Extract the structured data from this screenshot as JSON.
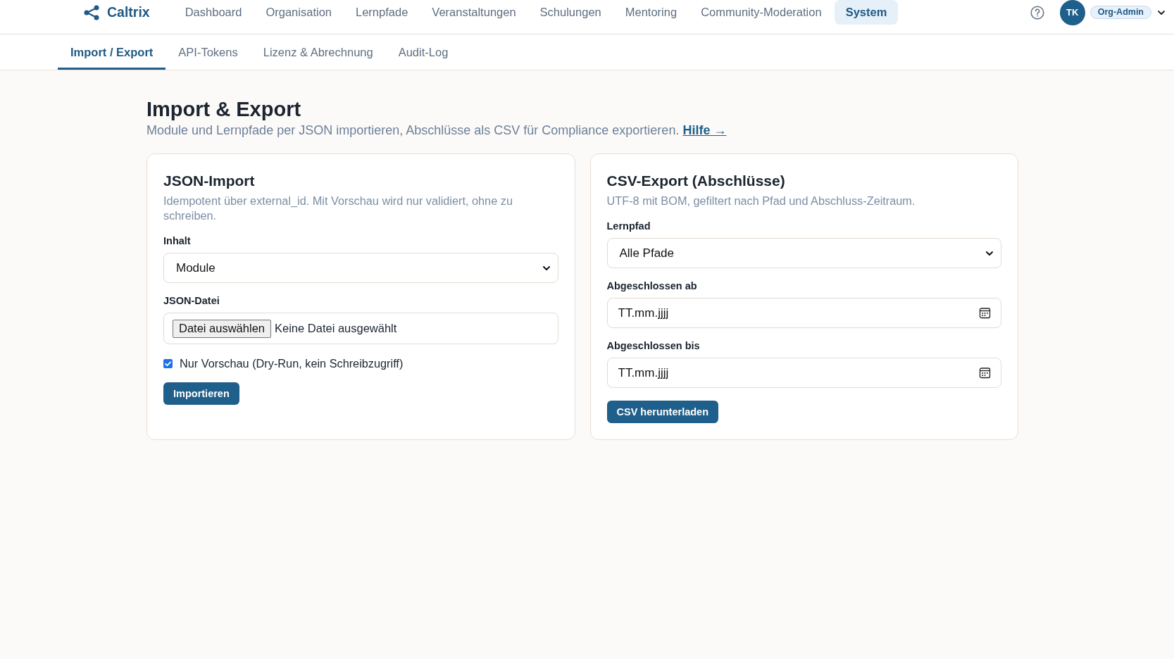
{
  "header": {
    "brand": "Caltrix",
    "nav": [
      {
        "label": "Dashboard",
        "selected": false
      },
      {
        "label": "Organisation",
        "selected": false
      },
      {
        "label": "Lernpfade",
        "selected": false
      },
      {
        "label": "Veranstaltungen",
        "selected": false
      },
      {
        "label": "Schulungen",
        "selected": false
      },
      {
        "label": "Mentoring",
        "selected": false
      },
      {
        "label": "Community-Moderation",
        "selected": false
      },
      {
        "label": "System",
        "selected": true
      }
    ],
    "avatar": "TK",
    "role": "Org-Admin"
  },
  "subnav": {
    "tabs": [
      {
        "label": "Import / Export",
        "selected": true
      },
      {
        "label": "API-Tokens",
        "selected": false
      },
      {
        "label": "Lizenz & Abrechnung",
        "selected": false
      },
      {
        "label": "Audit-Log",
        "selected": false
      }
    ]
  },
  "page": {
    "title": "Import & Export",
    "subtitle": "Module und Lernpfade per JSON importieren, Abschlüsse als CSV für Compliance exportieren.",
    "help_link": "Hilfe →"
  },
  "cards": [
    {
      "title": "JSON-Import",
      "description": "Idempotent über external_id. Mit Vorschau wird nur validiert, ohne zu schreiben.",
      "fields": [
        {
          "kind": "select",
          "label": "Inhalt",
          "value": "Module"
        },
        {
          "kind": "file",
          "label": "JSON-Datei",
          "button": "Datei auswählen",
          "status": "Keine Datei ausgewählt"
        },
        {
          "kind": "checkbox",
          "label": "Nur Vorschau (Dry-Run, kein Schreibzugriff)",
          "checked": true
        }
      ],
      "button": "Importieren"
    },
    {
      "title": "CSV-Export (Abschlüsse)",
      "description": "UTF-8 mit BOM, gefiltert nach Pfad und Abschluss-Zeitraum.",
      "fields": [
        {
          "kind": "select",
          "label": "Lernpfad",
          "value": "Alle Pfade"
        },
        {
          "kind": "date",
          "label": "Abgeschlossen ab",
          "placeholder": "TT.mm.jjjj"
        },
        {
          "kind": "date",
          "label": "Abgeschlossen bis",
          "placeholder": "TT.mm.jjjj"
        }
      ],
      "button": "CSV herunterladen"
    }
  ]
}
